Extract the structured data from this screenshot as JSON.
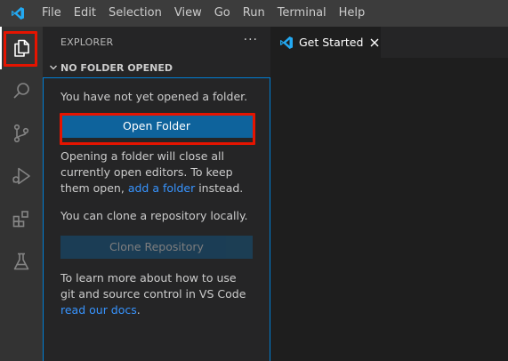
{
  "menubar": {
    "items": [
      "File",
      "Edit",
      "Selection",
      "View",
      "Go",
      "Run",
      "Terminal",
      "Help"
    ]
  },
  "activitybar": {
    "items": [
      {
        "icon": "files-icon",
        "active": true
      },
      {
        "icon": "search-icon",
        "active": false
      },
      {
        "icon": "source-control-icon",
        "active": false
      },
      {
        "icon": "run-debug-icon",
        "active": false
      },
      {
        "icon": "extensions-icon",
        "active": false
      },
      {
        "icon": "testing-flask-icon",
        "active": false
      }
    ]
  },
  "sidebar": {
    "title": "EXPLORER",
    "more_label": "···",
    "section_title": "NO FOLDER OPENED",
    "welcome": {
      "line1": "You have not yet opened a folder.",
      "open_folder_label": "Open Folder",
      "para2_part1": "Opening a folder will close all currently open editors. To keep them open, ",
      "para2_link": "add a folder",
      "para2_part2": " instead.",
      "clone_text": "You can clone a repository locally.",
      "clone_button_label": "Clone Repository",
      "para4_part1": "To learn more about how to use git and source control in VS Code ",
      "para4_link": "read our docs",
      "para4_part2": "."
    }
  },
  "editor": {
    "tab_label": "Get Started"
  },
  "colors": {
    "accent": "#0e639c",
    "highlight": "#e51400",
    "link": "#3794ff",
    "vscode_blue": "#23a9f2"
  }
}
